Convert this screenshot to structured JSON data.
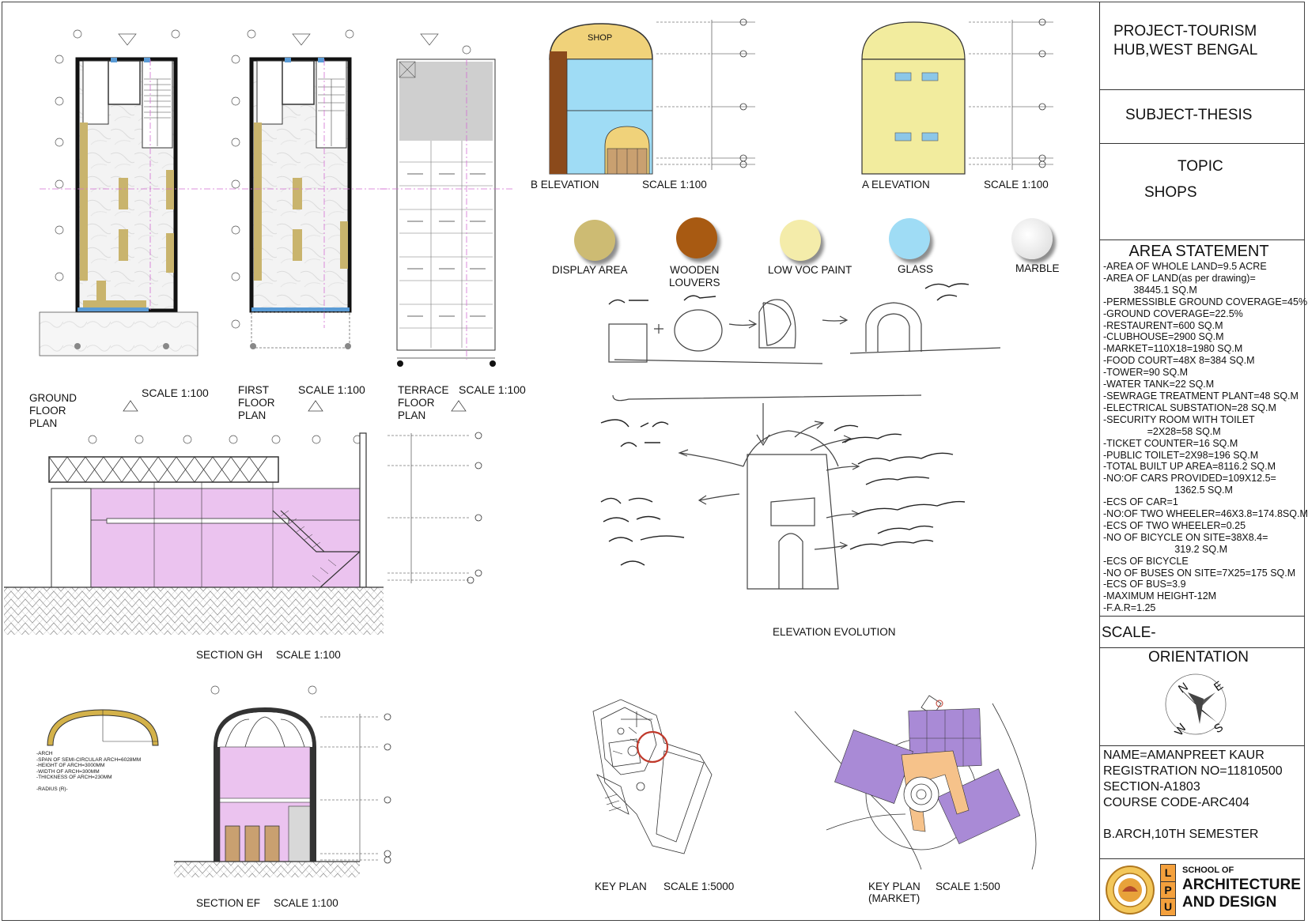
{
  "title_block": {
    "project": "PROJECT-TOURISM HUB,WEST BENGAL",
    "subject": "SUBJECT-THESIS",
    "topic_label": "TOPIC",
    "topic_value": "SHOPS",
    "area_statement_title": "AREA STATEMENT",
    "area_statement": [
      "-AREA OF WHOLE LAND=9.5 ACRE",
      "-AREA OF LAND(as per drawing)=",
      "           38445.1 SQ.M",
      "-PERMESSIBLE GROUND COVERAGE=45%",
      "-GROUND COVERAGE=22.5%",
      "-RESTAURENT=600 SQ.M",
      "-CLUBHOUSE=2900 SQ.M",
      "-MARKET=110X18=1980 SQ.M",
      "-FOOD COURT=48X 8=384 SQ.M",
      "-TOWER=90 SQ.M",
      "-WATER TANK=22 SQ.M",
      "-SEWRAGE TREATMENT PLANT=48 SQ.M",
      "-ELECTRICAL SUBSTATION=28 SQ.M",
      "-SECURITY ROOM WITH TOILET",
      "                =2X28=58 SQ.M",
      "-TICKET COUNTER=16 SQ.M",
      "-PUBLIC TOILET=2X98=196 SQ.M",
      "-TOTAL BUILT UP AREA=8116.2 SQ.M",
      "-NO:OF CARS PROVIDED=109X12.5=",
      "                          1362.5 SQ.M",
      "-ECS OF CAR=1",
      "-NO:OF TWO WHEELER=46X3.8=174.8SQ.M",
      "-ECS OF TWO WHEELER=0.25",
      "-NO OF BICYCLE ON SITE=38X8.4=",
      "                          319.2 SQ.M",
      "-ECS OF BICYCLE",
      "-NO OF BUSES ON SITE=7X25=175 SQ.M",
      "-ECS OF BUS=3.9",
      "-MAXIMUM HEIGHT-12M",
      "-F.A.R=1.25"
    ],
    "scale_label": "SCALE-",
    "orientation_label": "ORIENTATION",
    "compass": {
      "n": "N",
      "e": "E",
      "s": "S",
      "w": "W"
    },
    "student": {
      "name": "NAME=AMANPREET KAUR",
      "registration": "REGISTRATION NO=11810500",
      "section": "SECTION-A1803",
      "course": "COURSE CODE-ARC404",
      "program": "B.ARCH,10TH SEMESTER"
    },
    "school": {
      "name_line1": "SCHOOL OF",
      "name_line2": "ARCHITECTURE",
      "name_line3": "AND DESIGN",
      "logo_letters": [
        "L",
        "P",
        "U"
      ]
    }
  },
  "drawings": {
    "ground_floor": {
      "title": "GROUND\nFLOOR\nPLAN",
      "scale": "SCALE 1:100"
    },
    "first_floor": {
      "title": "FIRST\nFLOOR\nPLAN",
      "scale": "SCALE 1:100"
    },
    "terrace_floor": {
      "title": "TERRACE\nFLOOR\nPLAN",
      "scale": "SCALE 1:100"
    },
    "b_elevation": {
      "title": "B ELEVATION",
      "scale": "SCALE 1:100",
      "sign": "SHOP"
    },
    "a_elevation": {
      "title": "A ELEVATION",
      "scale": "SCALE 1:100"
    },
    "section_gh": {
      "title": "SECTION GH",
      "scale": "SCALE 1:100"
    },
    "section_ef": {
      "title": "SECTION EF",
      "scale": "SCALE 1:100"
    },
    "elevation_evolution": {
      "title": "ELEVATION EVOLUTION"
    },
    "key_plan_site": {
      "title": "KEY PLAN",
      "scale": "SCALE 1:5000"
    },
    "key_plan_market": {
      "title": "KEY PLAN\n(MARKET)",
      "scale": "SCALE 1:500"
    }
  },
  "arch_notes": [
    "-ARCH",
    "-SPAN OF SEMI-CIRCULAR ARCH=6028MM",
    "-HEIGHT OF ARCH=3000MM",
    "-WIDTH OF ARCH=300MM",
    "-THICKNESS OF ARCH=230MM",
    "",
    "-RADIUS (R)-"
  ],
  "materials": [
    {
      "label": "DISPLAY AREA",
      "color": "#cdbb73"
    },
    {
      "label": "WOODEN\nLOUVERS",
      "color": "#a85a12"
    },
    {
      "label": "LOW VOC PAINT",
      "color": "#f4ecaa"
    },
    {
      "label": "GLASS",
      "color": "#9fdcf5"
    },
    {
      "label": "MARBLE",
      "color": "#f2f2f2"
    }
  ],
  "colors": {
    "shop_fill": "#ebc3ef",
    "market_roof": "#a98ad6",
    "wall_yellow": "#f2ec9e",
    "glass": "#9fdcf5",
    "timber": "#8b4a1b",
    "display": "#c9b46d",
    "compass_red": "#c0392b"
  }
}
